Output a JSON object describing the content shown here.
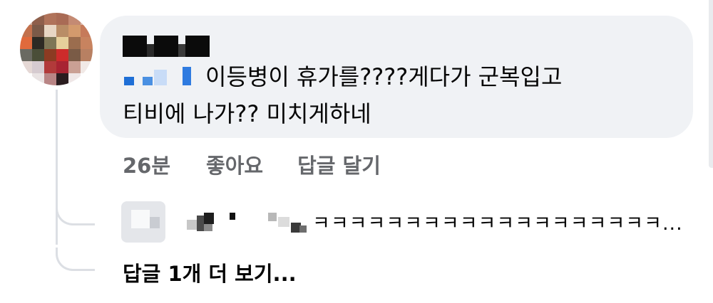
{
  "comment": {
    "line1": "이등병이 휴가를????게다가 군복입고",
    "line2": "티비에 나가?? 미치게하네"
  },
  "actions": {
    "time": "26분",
    "like": "좋아요",
    "reply": "답글 달기"
  },
  "reply_preview": {
    "text": "ㅋㅋㅋㅋㅋㅋㅋㅋㅋㅋㅋㅋㅋㅋㅋㅋㅋㅋㅋ..."
  },
  "more_replies": {
    "label": "답글 1개 더 보기..."
  },
  "colors": {
    "bubble": "#f0f2f5",
    "secondary_text": "#65676b",
    "thread_line": "#dcdfe4",
    "tag_blue": "#1a73e8"
  },
  "icons": {
    "avatar_main": "profile-avatar-pixelated",
    "avatar_reply": "profile-avatar-pixelated"
  }
}
